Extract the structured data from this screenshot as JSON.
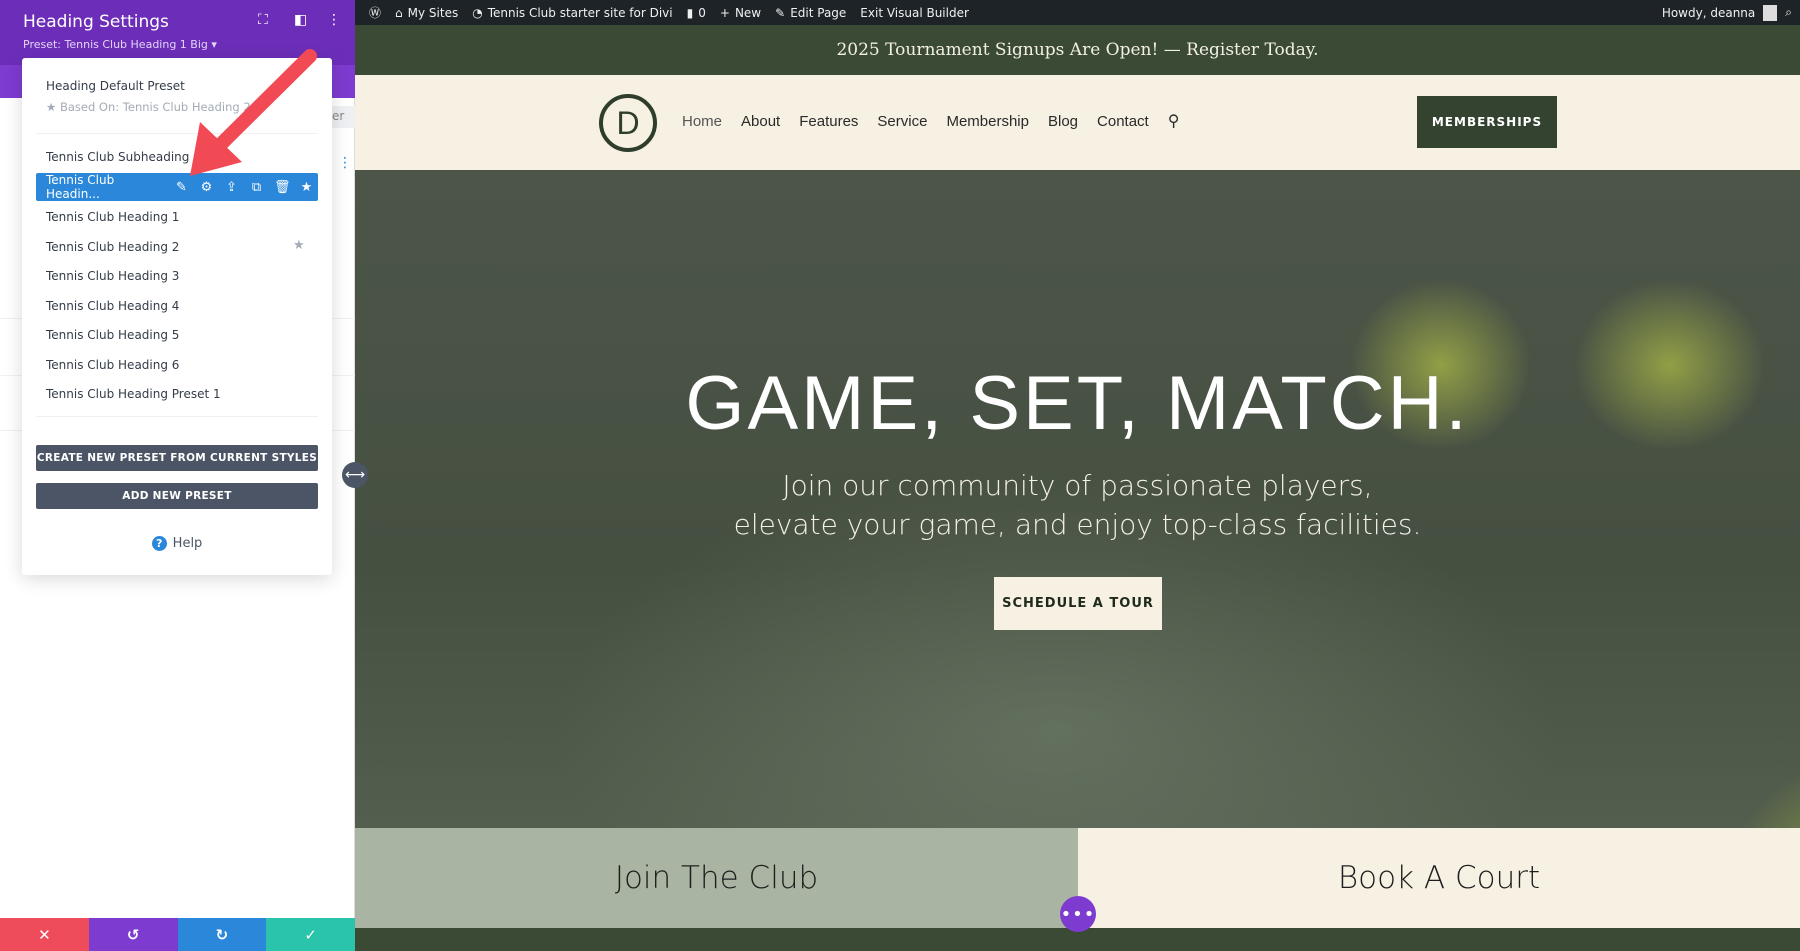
{
  "admin_bar": {
    "my_sites": "My Sites",
    "site_name": "Tennis Club starter site for Divi",
    "comments": "0",
    "new": "New",
    "edit_page": "Edit Page",
    "exit_builder": "Exit Visual Builder",
    "howdy": "Howdy, deanna"
  },
  "announcement": "2025 Tournament Signups Are Open! — Register Today.",
  "header": {
    "logo": "D",
    "nav": [
      "Home",
      "About",
      "Features",
      "Service",
      "Membership",
      "Blog",
      "Contact"
    ],
    "cta": "MEMBERSHIPS"
  },
  "hero": {
    "title": "GAME, SET, MATCH.",
    "subtitle_line1": "Join our community of passionate players,",
    "subtitle_line2": "elevate your game, and enjoy top-class facilities.",
    "button": "SCHEDULE A TOUR"
  },
  "cards": [
    "Join The Club",
    "Book A Court"
  ],
  "sidebar": {
    "title": "Heading Settings",
    "preset": "Preset: Tennis Club Heading 1 Big",
    "bg_tab_fragment": "er",
    "dropdown": {
      "default_preset": "Heading Default Preset",
      "based_on": "Based On: Tennis Club Heading 2",
      "subheading": "Tennis Club Subheading",
      "selected": "Tennis Club Headin...",
      "items": [
        "Tennis Club Heading 1",
        "Tennis Club Heading 2",
        "Tennis Club Heading 3",
        "Tennis Club Heading 4",
        "Tennis Club Heading 5",
        "Tennis Club Heading 6",
        "Tennis Club Heading Preset 1"
      ],
      "create_button": "CREATE NEW PRESET FROM CURRENT STYLES",
      "add_button": "ADD NEW PRESET",
      "help": "Help"
    }
  },
  "bottom_bar_colors": {
    "cancel": "#ef4c5b",
    "undo": "#7e3bd0",
    "redo": "#2b87da",
    "save": "#29c4a9"
  },
  "colors": {
    "accent_purple": "#6c2eb9",
    "brand_green": "#334330",
    "selected_blue": "#2b87da",
    "arrow_red": "#f24a55"
  }
}
